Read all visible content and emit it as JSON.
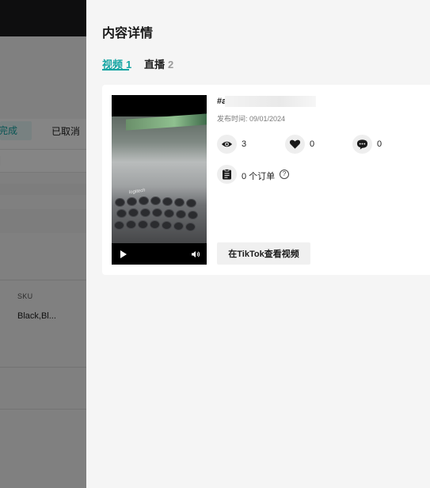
{
  "background": {
    "filter_tabs": {
      "active_label": "完成",
      "cancelled_label": "已取消"
    },
    "row_truncated_text": "|",
    "sku": {
      "header": "SKU",
      "value": "Black,Bl..."
    }
  },
  "drawer": {
    "title": "内容详情",
    "tabs": [
      {
        "label": "视频",
        "count": "1",
        "active": true
      },
      {
        "label": "直播",
        "count": "2",
        "active": false
      }
    ],
    "video_card": {
      "title": "#a",
      "publish_label": "发布时间: 09/01/2024",
      "thumbnail_brand": "logitech",
      "stats": {
        "views": "3",
        "likes": "0",
        "comments": "0"
      },
      "orders_label": "0 个订单",
      "help_glyph": "?",
      "view_button_label": "在TikTok查看视频"
    }
  },
  "colors": {
    "accent": "#15a5a3",
    "drawer_bg": "#f5f5f5",
    "card_bg": "#ffffff"
  },
  "icons": [
    "eye-icon",
    "heart-icon",
    "comment-icon",
    "clipboard-icon",
    "help-icon",
    "play-icon",
    "volume-icon"
  ]
}
